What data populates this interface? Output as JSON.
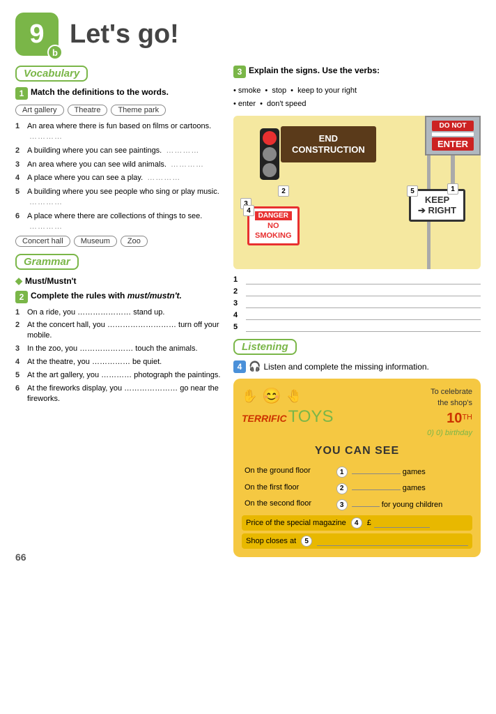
{
  "header": {
    "number": "9",
    "sub": "b",
    "title": "Let's go!"
  },
  "vocabulary": {
    "section_label": "Vocabulary",
    "exercise1": {
      "badge": "1",
      "instruction": "Match the definitions to the words.",
      "chips": [
        "Art gallery",
        "Theatre",
        "Theme park"
      ],
      "definitions": [
        {
          "num": "1",
          "text": "An area where there is fun based on films or cartoons.",
          "dots": "…………"
        },
        {
          "num": "2",
          "text": "A building where you can see paintings.",
          "dots": "…………"
        },
        {
          "num": "3",
          "text": "An area where you can see wild animals.",
          "dots": "…………"
        },
        {
          "num": "4",
          "text": "A place where you can see a play.",
          "dots": "…………"
        },
        {
          "num": "5",
          "text": "A building where you see people who sing or play music.",
          "dots": "…………"
        },
        {
          "num": "6",
          "text": "A place where there are collections of things to see.",
          "dots": "…………"
        }
      ],
      "chips2": [
        "Concert hall",
        "Museum",
        "Zoo"
      ]
    }
  },
  "grammar": {
    "section_label": "Grammar",
    "diamond": "◆",
    "must_title": "Must/Mustn't",
    "exercise2": {
      "badge": "2",
      "instruction": "Complete the rules with",
      "italic": "must/mustn't.",
      "items": [
        {
          "num": "1",
          "text": "On a ride, you ………………… stand up."
        },
        {
          "num": "2",
          "text": "At the concert hall, you ……………………… turn off your mobile."
        },
        {
          "num": "3",
          "text": "In the zoo, you ………………… touch the animals."
        },
        {
          "num": "4",
          "text": "At the theatre, you …………… be quiet."
        },
        {
          "num": "5",
          "text": "At the art gallery, you ………… photograph the paintings."
        },
        {
          "num": "6",
          "text": "At the fireworks display, you ………………… go near the fireworks."
        }
      ]
    }
  },
  "signs": {
    "exercise3_badge": "3",
    "instruction": "Explain the signs. Use the verbs:",
    "verbs": [
      "smoke",
      "stop",
      "keep to your right",
      "enter",
      "don't speed"
    ],
    "signs": [
      {
        "num": "1",
        "label": "DO NOT ENTER"
      },
      {
        "num": "2",
        "label": "END CONSTRUCTION"
      },
      {
        "num": "3",
        "label": "Traffic light"
      },
      {
        "num": "4",
        "label": "DANGER NO SMOKING"
      },
      {
        "num": "5",
        "label": "KEEP RIGHT"
      }
    ],
    "answer_lines": [
      "1",
      "2",
      "3",
      "4",
      "5"
    ]
  },
  "listening": {
    "section_label": "Listening",
    "exercise4_badge": "4",
    "instruction": "Listen and complete the missing information.",
    "card": {
      "brand": "TERRIFIC TOYS",
      "terrific": "TERRIFIC",
      "toys": "TOYS",
      "celebrate": "To celebrate",
      "shop_s": "the shop's",
      "birthday_num": "10",
      "birthday_sup": "TH",
      "birthday_label": "birthday",
      "answer_0": "0) birthday",
      "you_can_see": "YOU CAN SEE",
      "floors": [
        {
          "label": "On the ground floor",
          "num": "1",
          "suffix": "games"
        },
        {
          "label": "On the first floor",
          "num": "2",
          "suffix": "games"
        },
        {
          "label": "On the second floor",
          "num": "3",
          "suffix": "for young children"
        }
      ],
      "price_label": "Price of the special magazine",
      "price_num": "4",
      "price_prefix": "£",
      "shop_closes_label": "Shop closes at",
      "shop_closes_num": "5"
    }
  },
  "page_number": "66"
}
